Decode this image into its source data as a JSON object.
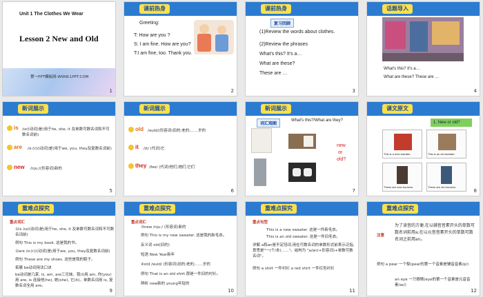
{
  "slides": [
    {
      "num": "1",
      "unit": "Unit 1 The Clothes We Wear",
      "title": "Lesson 2  New and Old",
      "footer": "第一PPT模板网-WWW.1PPT.COM"
    },
    {
      "num": "2",
      "tag": "课前热身",
      "lines": [
        "Greeting:",
        "T: How are you ?",
        "S: I am fine. How are you?",
        "T:I am fine, too. Thank you."
      ]
    },
    {
      "num": "3",
      "tag": "课前热身",
      "box": "复习回顾",
      "lines": [
        "(1)Review the words about clothes.",
        "(2)Review the phrases",
        "What's this? It's a…",
        "What are these?",
        "These are …"
      ]
    },
    {
      "num": "4",
      "tag": "话题导入",
      "lines": [
        "What's this? It's a…",
        "What are these? These are …"
      ]
    },
    {
      "num": "5",
      "tag": "新词展示",
      "words": [
        {
          "w": "is",
          "d": "/ɪz/(动词)是(用于he, she, it 及单数可数名词和不可数名词前)"
        },
        {
          "w": "are",
          "d": "/ɑ:(r)/(动词)是(用于we, you, they及复数名词前)"
        },
        {
          "w": "new",
          "d": "/nju:/(形容词)新的"
        }
      ]
    },
    {
      "num": "6",
      "tag": "新词展示",
      "words": [
        {
          "w": "old",
          "d": "/əuld/(形容词)旧的;老的;……岁的"
        },
        {
          "w": "it",
          "d": "/ɪt/  (代词)它"
        },
        {
          "w": "they",
          "d": "/ðeɪ/ (代词)他们;她们;它们"
        }
      ]
    },
    {
      "num": "7",
      "tag": "新词展示",
      "box": "词汇观图",
      "lines": [
        "What's this?/What are they?"
      ],
      "side": [
        "new",
        "or",
        "old?"
      ]
    },
    {
      "num": "8",
      "tag": "课文原文",
      "box": "1. New or old?",
      "captions": [
        "This is a new sweater.",
        "This is an old sweater.",
        "These are new trousers.",
        "These are old trousers."
      ]
    },
    {
      "num": "9",
      "tag": "重难点探究",
      "box": "重点词汇",
      "lines": [
        "①is /ɪz/(动词)是(用于he, she, it 及单数可数名词和不可数名词前)",
        "例句 This is my book. 这是我的书。",
        "②are /ɑ:(r)/(动词)是(用于we, you, they及复数名词前)",
        "例句 These are my shoes. 这些是我的鞋子。",
        "拓展 be动词用法口诀",
        "be动词是几家, is, am, are三兄妹。我(I)用 am, 你(you)用 are, is 连接他(he), 她(she), 它(it)。单数名词用 is, 复数名词全用 are。"
      ]
    },
    {
      "num": "10",
      "tag": "重难点探究",
      "box": "重点词汇",
      "lines": [
        "③new /nju:/ (形容词)新的",
        "例句 This is my new sweater. 这是我的新毛衣。",
        "反义词 old(旧的)",
        "短语 New Year新年",
        "④old /əuld/ (形容词)旧的;老的;……岁的",
        "例句 That is an old shirt.那是一件旧的衬衫。",
        "辨析 new新的  young年轻的"
      ]
    },
    {
      "num": "11",
      "tag": "重难点探究",
      "box": "重点句型",
      "lines": [
        "This is a new sweater. 这是一件新毛衣。",
        "This is an old sweater. 这是一件旧毛衣。",
        "详解 a和an是不定冠词,用在可数名词的单数形式前表示泛指,意思是\"一(个/本)……\"。结构为 \"a/an(+形容词)+单数可数名词\"。",
        "例句 a shirt 一件衬衫   a red shirt 一件红色衬衫"
      ]
    },
    {
      "num": "12",
      "tag": "重难点探究",
      "lines": [
        "为了读音的方便,在以辅音音素开头的单数可数名词前用a;在以元音音素开头的单数可数名词之前用an。",
        "注意",
        "例句 a pear 一个梨(pear的第一个音素是辅音音素/p/)",
        "an eye 一只眼睛(eye的第一个音素是元音音素/aɪ/)"
      ]
    }
  ]
}
